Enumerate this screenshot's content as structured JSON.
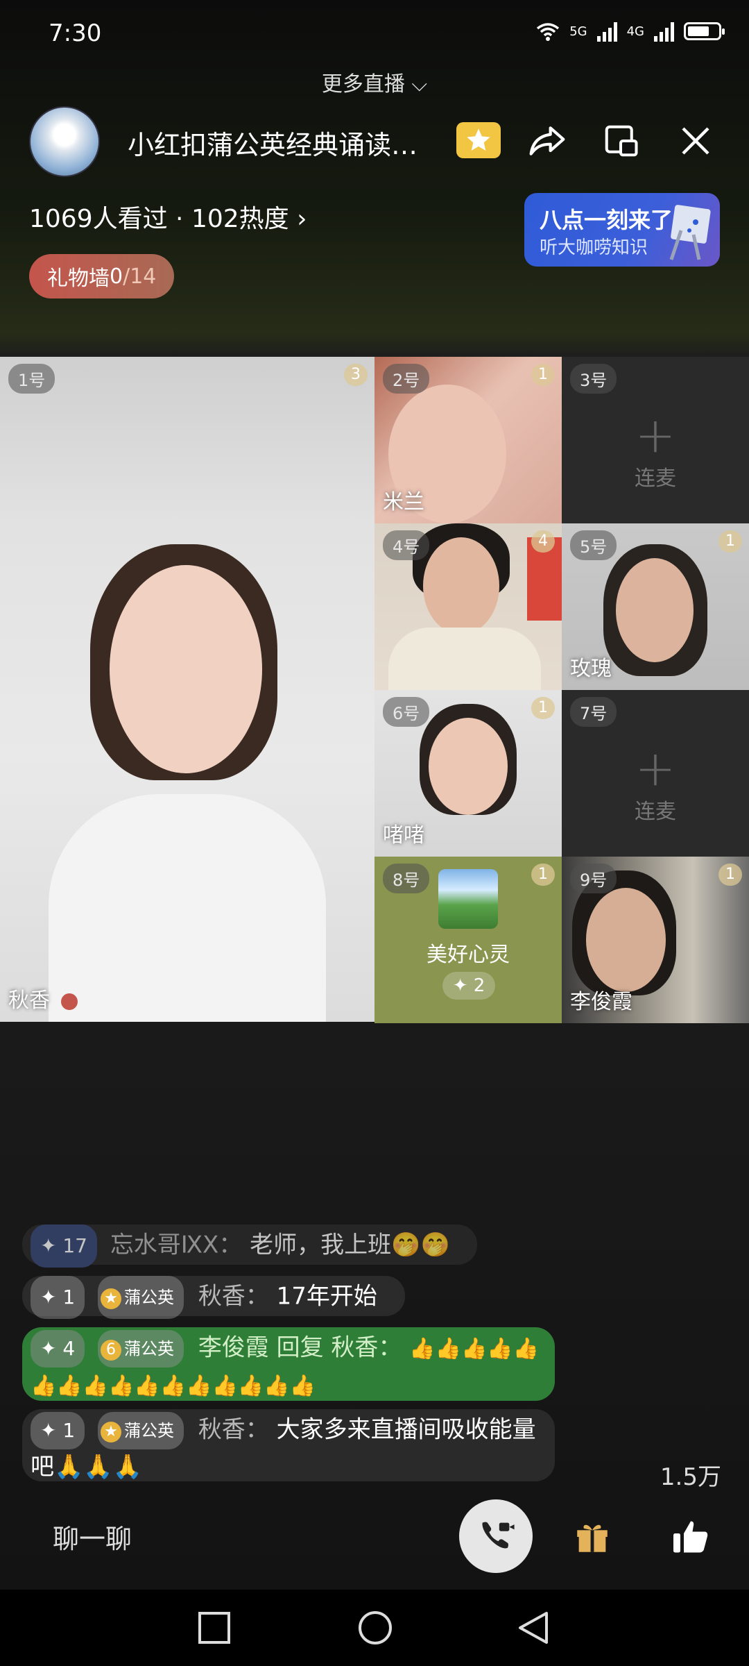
{
  "status": {
    "time": "7:30",
    "net1": "5G",
    "net2": "4G"
  },
  "header": {
    "more_live": "更多直播 ⌵",
    "title": "小红扣蒲公英经典诵读…",
    "stats": "1069人看过 · 102热度 ›"
  },
  "promo": {
    "line1": "八点一刻来了",
    "line2": "听大咖唠知识"
  },
  "gift_wall": {
    "label": "礼物墙 ",
    "value": "0",
    "total": "/14"
  },
  "seats": [
    {
      "num": "1号",
      "count": "3",
      "name": "秋香"
    },
    {
      "num": "2号",
      "count": "1",
      "name": "米兰"
    },
    {
      "num": "3号",
      "action": "连麦"
    },
    {
      "num": "4号",
      "count": "4"
    },
    {
      "num": "5号",
      "count": "1",
      "name": "玫瑰"
    },
    {
      "num": "6号",
      "count": "1",
      "name": "啫啫"
    },
    {
      "num": "7号",
      "action": "连麦"
    },
    {
      "num": "8号",
      "count": "1",
      "name": "美好心灵",
      "gift": "✦ 2"
    },
    {
      "num": "9号",
      "count": "1",
      "name": "李俊霞"
    }
  ],
  "chat": [
    {
      "level": "✦ 17",
      "user": "忘水哥ⅨX：",
      "text": "老师，我上班🤭🤭"
    },
    {
      "level": "✦ 1",
      "badge_num": "★",
      "badge": "蒲公英",
      "user": "秋香：",
      "text": "17年开始"
    },
    {
      "level": "✦ 4",
      "badge_num": "6",
      "badge": "蒲公英",
      "user": "李俊霞 回复 秋香：",
      "text": "👍👍👍👍👍👍👍👍👍👍👍👍👍👍👍👍"
    },
    {
      "level": "✦ 1",
      "badge_num": "★",
      "badge": "蒲公英",
      "user": "秋香：",
      "text": "大家多来直播间吸收能量吧🙏🙏🙏"
    }
  ],
  "bottom": {
    "input_placeholder": "聊一聊",
    "likes": "1.5万"
  },
  "colors": {
    "accent_green": "#2f7e38",
    "promo_blue": "#2f5bd8",
    "gift_wall": "#c4554c"
  }
}
